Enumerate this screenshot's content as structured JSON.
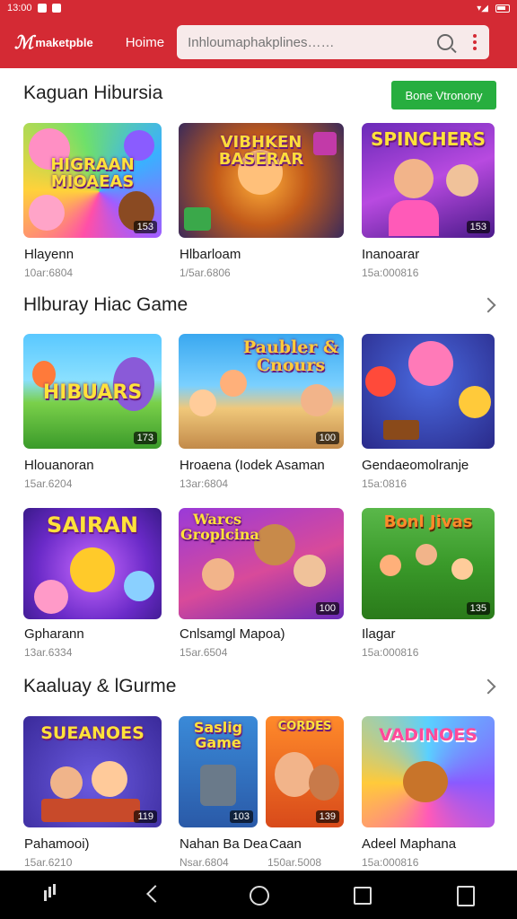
{
  "status": {
    "time": "13:00",
    "right": "▾ ◢ ▮"
  },
  "appbar": {
    "logo": "maketpble",
    "home": "Hoime",
    "search_placeholder": "Inhloumaphakplines……"
  },
  "sections": [
    {
      "title": "Kaguan Hibursia",
      "button": "Bone Vtronony",
      "cards": [
        {
          "name": "Hlayenn",
          "meta": "10ar:6804",
          "badge": "153",
          "art_title": "HIGRAAN MIOAEAS"
        },
        {
          "name": "Hlbarloam",
          "meta": "1/5ar.6806",
          "badge": "",
          "art_title": "VIBHKEN BASERAR"
        },
        {
          "name": "Inanoarar",
          "meta": "15a:000816",
          "badge": "153",
          "art_title": "SPINCHERS"
        }
      ]
    },
    {
      "title": "Hlburay Hiac Game",
      "cards": [
        {
          "name": "Hlouanoran",
          "meta": "15ar.6204",
          "badge": "173",
          "art_title": "HIBUARS"
        },
        {
          "name": "Hroaena (Iodek Asaman",
          "meta": "13ar:6804",
          "badge": "100",
          "art_title": "Paubler & Cnours"
        },
        {
          "name": "Gendaeomolranje",
          "meta": "15a:0816",
          "badge": "",
          "art_title": ""
        },
        {
          "name": "Gpharann",
          "meta": "13ar.6334",
          "badge": "",
          "art_title": "SAIRAN"
        },
        {
          "name": "Cnlsamgl Mapoa)",
          "meta": "15ar.6504",
          "badge": "100",
          "art_title": "Warcs Groplcina"
        },
        {
          "name": "Ilagar",
          "meta": "15a:000816",
          "badge": "135",
          "art_title": "Bonl Jivas"
        }
      ]
    },
    {
      "title": "Kaaluay & lGurme",
      "cards": [
        {
          "name": "Pahamooi)",
          "meta": "15ar.6210",
          "badge": "119",
          "art_title": "SUEANOES"
        },
        {
          "name": "Nahan Ba Dea",
          "meta": "Nsar.6804",
          "badge": "103",
          "art_title": "Saslig Game"
        },
        {
          "name": "Caan",
          "meta": "150ar.5008",
          "badge": "139",
          "art_title": "CORDES"
        },
        {
          "name": "Adeel Maphana",
          "meta": "15a:000816",
          "badge": "",
          "art_title": "VADINOES"
        }
      ]
    }
  ],
  "colors": {
    "brand": "#d42a34",
    "accent_button": "#27ae3f"
  }
}
